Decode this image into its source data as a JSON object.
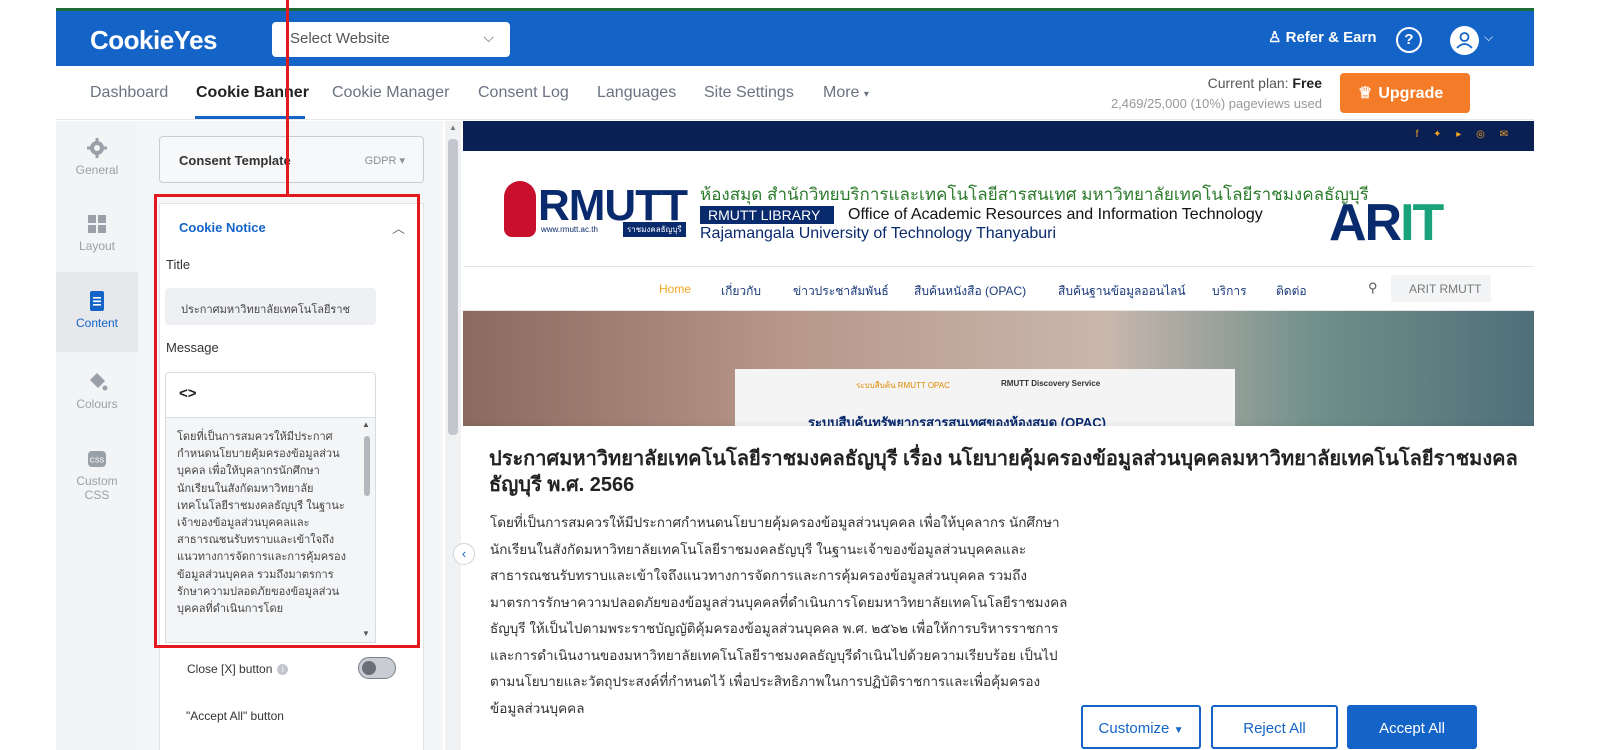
{
  "app": {
    "logo": "CookieYes",
    "site_select": "Select Website",
    "refer": "Refer & Earn",
    "help": "?"
  },
  "nav": {
    "items": [
      "Dashboard",
      "Cookie Banner",
      "Cookie Manager",
      "Consent Log",
      "Languages",
      "Site Settings",
      "More"
    ],
    "active": "Cookie Banner",
    "plan_label": "Current plan:",
    "plan_value": "Free",
    "usage": "2,469/25,000 (10%) pageviews used",
    "upgrade": "Upgrade"
  },
  "rail": {
    "items": [
      {
        "label": "General",
        "icon": "gear-icon"
      },
      {
        "label": "Layout",
        "icon": "layout-grid-icon"
      },
      {
        "label": "Content",
        "icon": "document-icon"
      },
      {
        "label": "Colours",
        "icon": "paint-bucket-icon"
      },
      {
        "label": "Custom CSS",
        "icon": "css-icon"
      }
    ],
    "active": "Content"
  },
  "panel": {
    "template_label": "Consent Template",
    "template_value": "GDPR",
    "notice_title": "Cookie Notice",
    "title_label": "Title",
    "title_value": "ประกาศมหาวิทยาลัยเทคโนโลยีราช",
    "message_label": "Message",
    "code_button": "<>",
    "message_value": "โดยที่เป็นการสมควรให้มีประกาศกำหนดนโยบายคุ้มครองข้อมูลส่วนบุคคล เพื่อให้บุคลากรนักศึกษา นักเรียนในสังกัดมหาวิทยาลัยเทคโนโลยีราชมงคลธัญบุรี ในฐานะเจ้าของข้อมูลส่วนบุคคลและสาธารณชนรับทราบและเข้าใจถึงแนวทางการจัดการและการคุ้มครองข้อมูลส่วนบุคคล รวมถึงมาตรการรักษาความปลอดภัยของข้อมูลส่วนบุคคลที่ดำเนินการโดย",
    "close_label": "Close [X] button",
    "accept_all_label": "\"Accept All\" button"
  },
  "preview": {
    "logo": "RMUTT",
    "url": "www.rmutt.ac.th",
    "url_badge": "ราชมงคลธัญบุรี",
    "thai_header": "ห้องสมุด สำนักวิทยบริการและเทคโนโลยีสารสนเทศ มหาวิทยาลัยเทคโนโลยีราชมงคลธัญบุรี",
    "library": "RMUTT LIBRARY",
    "office": "Office of Academic Resources and Information Technology",
    "university": "Rajamangala University of Technology Thanyaburi",
    "arit_a": "ARIT",
    "social": "f ✦ ▸ ◎ ✉",
    "menu": [
      "Home",
      "เกี่ยวกับ",
      "ข่าวประชาสัมพันธ์",
      "สืบค้นหนังสือ (OPAC)",
      "สืบค้นฐานข้อมูลออนไลน์",
      "บริการ",
      "ติดต่อ"
    ],
    "search_placeholder": "ARIT RMUTT",
    "hero_tab1": "ระบบสืบค้น RMUTT OPAC",
    "hero_tab2": "RMUTT Discovery Service",
    "hero_heading": "ระบบสืบค้นทรัพยากรสารสนเทศของห้องสมุด (OPAC)",
    "cookie_title": "ประกาศมหาวิทยาลัยเทคโนโลยีราชมงคลธัญบุรี เรื่อง นโยบายคุ้มครองข้อมูลส่วนบุคคลมหาวิทยาลัยเทคโนโลยีราชมงคลธัญบุรี พ.ศ. 2566",
    "cookie_message": "โดยที่เป็นการสมควรให้มีประกาศกำหนดนโยบายคุ้มครองข้อมูลส่วนบุคคล เพื่อให้บุคลากร นักศึกษา นักเรียนในสังกัดมหาวิทยาลัยเทคโนโลยีราชมงคลธัญบุรี ในฐานะเจ้าของข้อมูลส่วนบุคคลและสาธารณชนรับทราบและเข้าใจถึงแนวทางการจัดการและการคุ้มครองข้อมูลส่วนบุคคล รวมถึงมาตรการรักษาความปลอดภัยของข้อมูลส่วนบุคคลที่ดำเนินการโดยมหาวิทยาลัยเทคโนโลยีราชมงคลธัญบุรี ให้เป็นไปตามพระราชบัญญัติคุ้มครองข้อมูลส่วนบุคคล พ.ศ. ๒๕๖๒ เพื่อให้การบริหารราชการและการดำเนินงานของมหาวิทยาลัยเทคโนโลยีราชมงคลธัญบุรีดำเนินไปด้วยความเรียบร้อย เป็นไปตามนโยบายและวัตถุประสงค์ที่กำหนดไว้ เพื่อประสิทธิภาพในการปฏิบัติราชการและเพื่อคุ้มครองข้อมูลส่วนบุคคล",
    "buttons": {
      "customize": "Customize",
      "reject": "Reject All",
      "accept": "Accept All"
    }
  },
  "colors": {
    "brand": "#1464c8",
    "upgrade": "#f47b28",
    "highlight": "#e3191e"
  }
}
